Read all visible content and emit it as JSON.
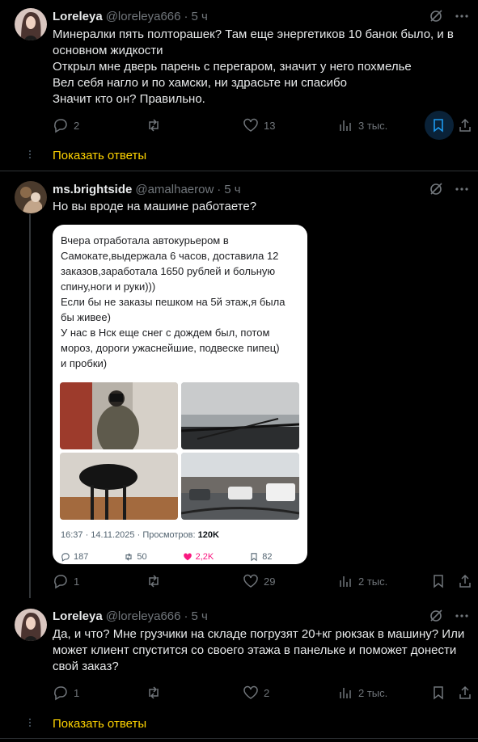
{
  "tweets": [
    {
      "name": "Loreleya",
      "handle": "@loreleya666",
      "time": "5 ч",
      "lines": [
        "Минералки пять полторашек? Там еще энергетиков 10 банок было, и в",
        "основном жидкости",
        "Открыл мне дверь парень с перегаром, значит у него похмелье",
        "Вел себя нагло и по хамски, ни здрасьте ни спасибо",
        "Значит кто он? Правильно."
      ],
      "replies": "2",
      "retweets": "",
      "likes": "13",
      "views": "3 тыс."
    },
    {
      "name": "ms.brightside",
      "handle": "@amalhaerow",
      "time": "5 ч",
      "lines": [
        "Но вы вроде на машине работаете?"
      ],
      "replies": "1",
      "retweets": "",
      "likes": "29",
      "views": "2 тыс."
    },
    {
      "name": "Loreleya",
      "handle": "@loreleya666",
      "time": "5 ч",
      "lines": [
        "Да, и что? Мне грузчики на складе погрузят 20+кг рюкзак в машину? Или",
        "может клиент спустится со своего этажа в панельке и поможет донести",
        "свой заказ?"
      ],
      "replies": "1",
      "retweets": "",
      "likes": "2",
      "views": "2 тыс."
    }
  ],
  "show_replies_label": "Показать ответы",
  "embed": {
    "lines": [
      "Вчера отработала автокурьером в",
      "Самокате,выдержала 6 часов, доставила 12",
      "заказов,заработала 1650 рублей и больную",
      "спину,ноги и руки)))",
      "Если бы не заказы пешком на 5й этаж,я была",
      "бы живее)",
      "У нас в Нск еще снег с дождем был, потом",
      "мороз, дороги ужаснейшие, подвеске пипец)",
      "и пробки)"
    ],
    "meta": "16:37 · 14.11.2025 · Просмотров: ",
    "views": "120K",
    "stats": {
      "replies": "187",
      "retweets": "50",
      "likes": "2,2K",
      "bookmarks": "82"
    }
  },
  "colors": {
    "accent": "#ffd400",
    "muted": "#71767b",
    "bookmark_active": "#1d9bf0",
    "like": "#f91880"
  }
}
